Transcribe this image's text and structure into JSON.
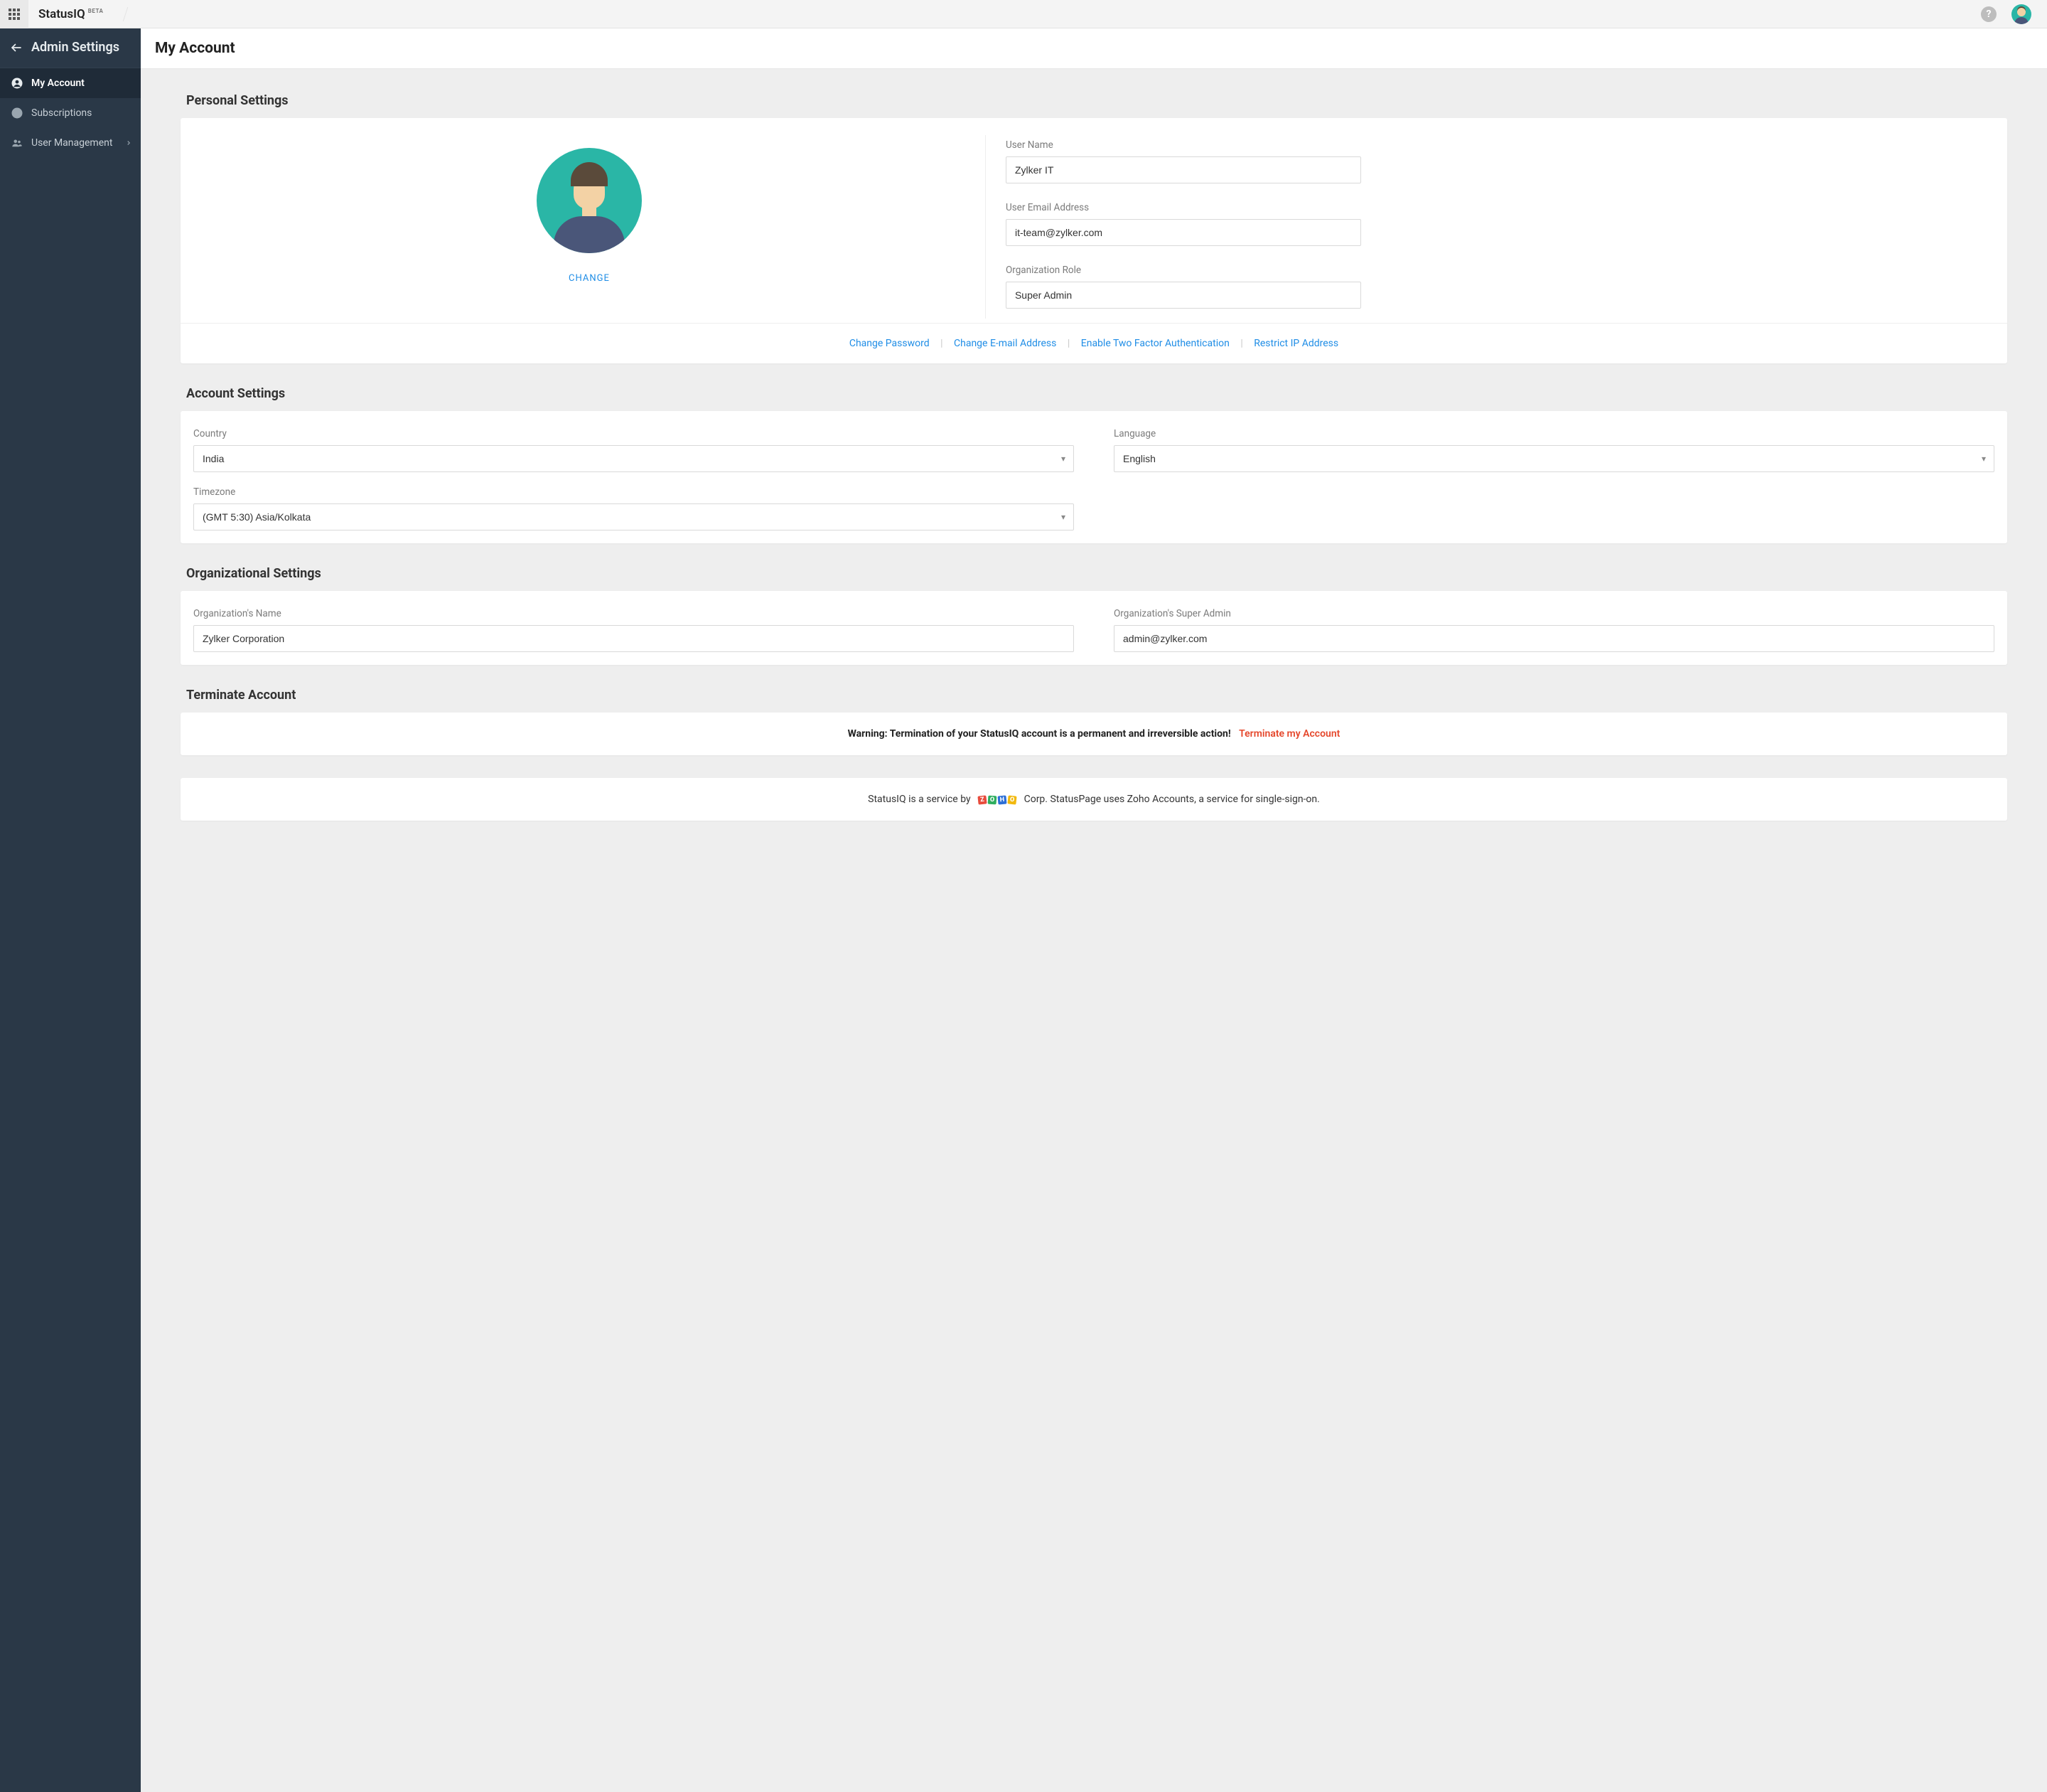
{
  "topbar": {
    "brand": "StatusIQ",
    "brand_suffix": "BETA"
  },
  "sidebar": {
    "title": "Admin Settings",
    "items": [
      {
        "id": "my-account",
        "label": "My Account",
        "active": true
      },
      {
        "id": "subscriptions",
        "label": "Subscriptions",
        "active": false
      },
      {
        "id": "user-management",
        "label": "User Management",
        "active": false,
        "has_submenu": true
      }
    ]
  },
  "page": {
    "title": "My Account"
  },
  "personal": {
    "section_title": "Personal Settings",
    "change_label": "CHANGE",
    "username_label": "User Name",
    "username_value": "Zylker IT",
    "email_label": "User Email Address",
    "email_value": "it-team@zylker.com",
    "role_label": "Organization Role",
    "role_value": "Super Admin",
    "links": {
      "change_password": "Change Password",
      "change_email": "Change E-mail Address",
      "two_factor": "Enable Two Factor Authentication",
      "restrict_ip": "Restrict IP Address"
    }
  },
  "account": {
    "section_title": "Account Settings",
    "country_label": "Country",
    "country_value": "India",
    "language_label": "Language",
    "language_value": "English",
    "timezone_label": "Timezone",
    "timezone_value": "(GMT 5:30) Asia/Kolkata"
  },
  "org": {
    "section_title": "Organizational Settings",
    "name_label": "Organization's Name",
    "name_value": "Zylker Corporation",
    "admin_label": "Organization's Super Admin",
    "admin_value": "admin@zylker.com"
  },
  "terminate": {
    "section_title": "Terminate Account",
    "warning": "Warning: Termination of your StatusIQ account is a permanent and irreversible action!",
    "link": "Terminate my Account"
  },
  "footer": {
    "prefix": "StatusIQ is a service by",
    "suffix": "Corp. StatusPage uses Zoho Accounts, a service for single-sign-on."
  }
}
